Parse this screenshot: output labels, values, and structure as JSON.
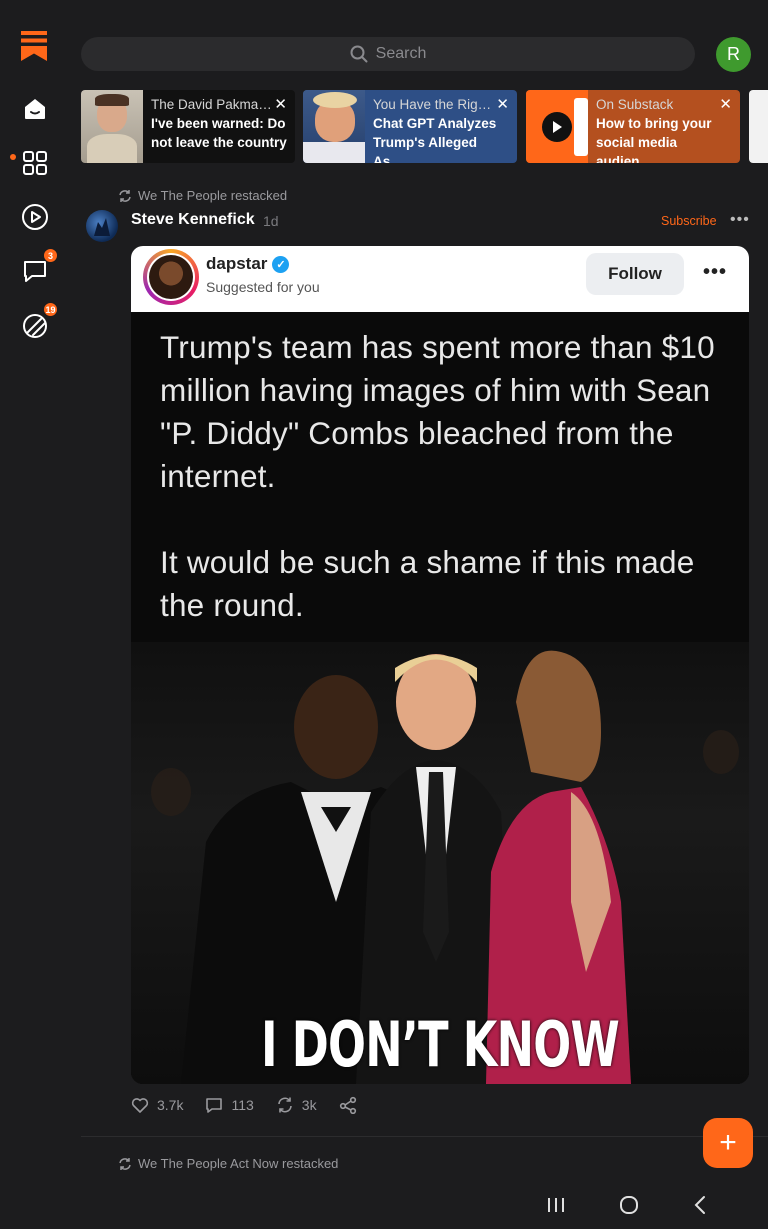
{
  "search": {
    "placeholder": "Search",
    "icon": "search-icon"
  },
  "user": {
    "initial": "R",
    "color": "#3f9a2e"
  },
  "accent": "#ff6719",
  "sidebar": {
    "items": [
      {
        "name": "home",
        "icon": "home-icon"
      },
      {
        "name": "explore",
        "icon": "grid-icon",
        "active": true
      },
      {
        "name": "video",
        "icon": "play-icon"
      },
      {
        "name": "chat",
        "icon": "chat-icon",
        "badge": "3"
      },
      {
        "name": "activity",
        "icon": "activity-icon",
        "badge": "19"
      }
    ]
  },
  "stories": [
    {
      "source": "The David Pakma…",
      "title": "I've been warned: Do not leave the country",
      "bg": "#111111"
    },
    {
      "source": "You Have the Rig…",
      "title": "Chat GPT Analyzes Trump's Alleged As…",
      "bg": "#2e4f86"
    },
    {
      "source": "On Substack",
      "title": "How to bring your social media audien…",
      "bg": "#b4501f"
    }
  ],
  "post": {
    "restacked_by": "We The People restacked",
    "author": "Steve Kennefick",
    "time": "1d",
    "subscribe_label": "Subscribe",
    "embed": {
      "username": "dapstar",
      "subtitle": "Suggested for you",
      "follow_label": "Follow",
      "text_1": "Trump's team has spent more than $10 million having images of him with Sean \"P. Diddy\" Combs bleached from the internet.",
      "text_2": "It would be such a shame if this made the round.",
      "caption": "I DON’T KNOW HIM"
    },
    "likes": "3.7k",
    "comments": "113",
    "restacks": "3k"
  },
  "next_post": {
    "restacked_by": "We The People Act Now restacked"
  }
}
